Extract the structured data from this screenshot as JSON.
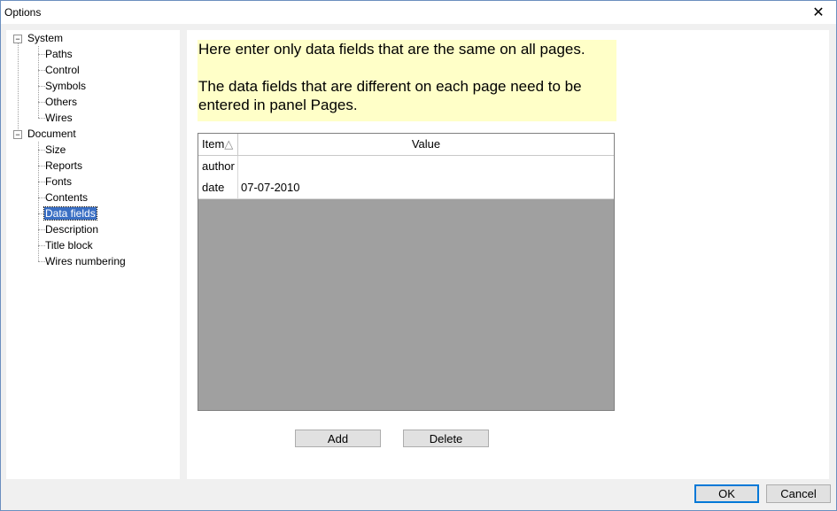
{
  "window": {
    "title": "Options",
    "close_glyph": "✕"
  },
  "tree": {
    "groups": [
      {
        "label": "System",
        "expander": "−",
        "children": [
          "Paths",
          "Control",
          "Symbols",
          "Others",
          "Wires"
        ]
      },
      {
        "label": "Document",
        "expander": "−",
        "children": [
          "Size",
          "Reports",
          "Fonts",
          "Contents",
          "Data fields",
          "Description",
          "Title block",
          "Wires numbering"
        ]
      }
    ],
    "selected": "Data fields"
  },
  "info": {
    "line1": "Here enter only data fields that are the same on all pages.",
    "line2": "The data fields that are different on each page need to be entered in panel Pages."
  },
  "grid": {
    "columns": [
      "Item",
      "Value"
    ],
    "sort_glyph": "△",
    "rows": [
      {
        "item": "author",
        "value": ""
      },
      {
        "item": "date",
        "value": "07-07-2010"
      }
    ]
  },
  "buttons": {
    "add": "Add",
    "delete": "Delete",
    "ok": "OK",
    "cancel": "Cancel"
  },
  "colors": {
    "info_background": "#ffffc8",
    "selection": "#3a6fc4",
    "grid_empty": "#a0a0a0",
    "ok_border": "#0078d7"
  }
}
